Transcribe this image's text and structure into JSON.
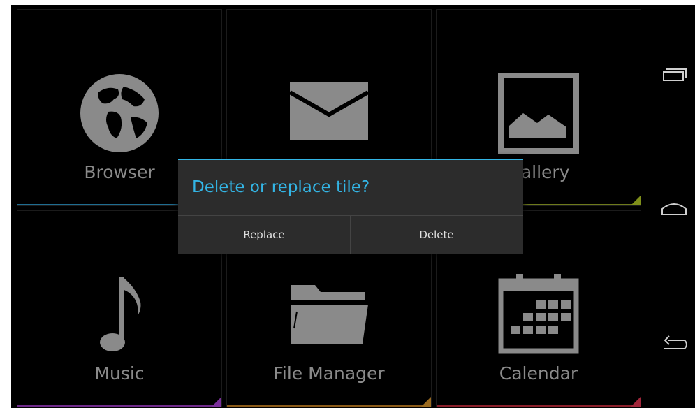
{
  "tiles": [
    {
      "label": "Browser",
      "icon": "globe-icon"
    },
    {
      "label": "",
      "icon": "email-icon"
    },
    {
      "label": "Gallery",
      "icon": "gallery-icon"
    },
    {
      "label": "Music",
      "icon": "music-note-icon"
    },
    {
      "label": "File Manager",
      "icon": "folder-icon"
    },
    {
      "label": "Calendar",
      "icon": "calendar-icon"
    }
  ],
  "dialog": {
    "title": "Delete or replace tile?",
    "replace_label": "Replace",
    "delete_label": "Delete"
  },
  "navbar": [
    "recent-apps-icon",
    "home-icon",
    "back-icon"
  ],
  "colors": {
    "accent": "#33b5e5",
    "icon_gray": "#8a8a8a",
    "dialog_bg": "#2c2c2c"
  }
}
